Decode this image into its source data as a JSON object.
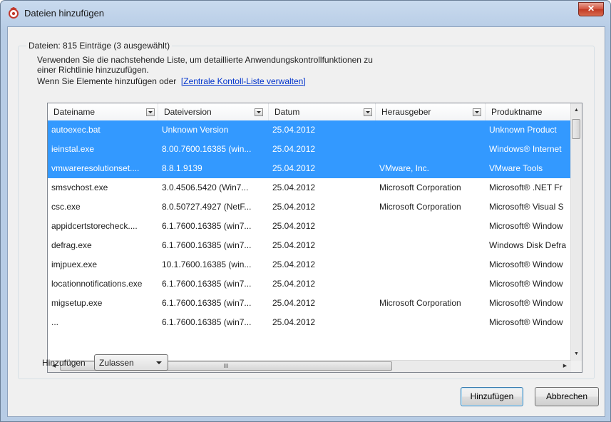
{
  "window": {
    "title": "Dateien hinzufügen",
    "close_glyph": "✕"
  },
  "group": {
    "label": "Dateien: 815 Einträge (3 ausgewählt)",
    "desc_line1": "Verwenden Sie die nachstehende Liste, um detaillierte Anwendungskontrollfunktionen zu",
    "desc_line2": "einer Richtlinie hinzuzufügen.",
    "desc_line3": "Wenn Sie Elemente hinzufügen oder",
    "desc_link": "[Zentrale Kontoll-Liste verwalten]"
  },
  "table": {
    "columns": [
      "Dateiname",
      "Dateiversion",
      "Datum",
      "Herausgeber",
      "Produktname"
    ],
    "rows": [
      {
        "name": "autoexec.bat",
        "version": "Unknown Version",
        "date": "25.04.2012",
        "publisher": "",
        "product": "Unknown Product",
        "selected": true
      },
      {
        "name": "ieinstal.exe",
        "version": "8.00.7600.16385 (win...",
        "date": "25.04.2012",
        "publisher": "",
        "product": "Windows® Internet",
        "selected": true
      },
      {
        "name": "vmwareresolutionset....",
        "version": "8.8.1.9139",
        "date": "25.04.2012",
        "publisher": "VMware, Inc.",
        "product": "VMware Tools",
        "selected": true
      },
      {
        "name": "smsvchost.exe",
        "version": "3.0.4506.5420 (Win7...",
        "date": "25.04.2012",
        "publisher": "Microsoft Corporation",
        "product": "Microsoft® .NET Fr",
        "selected": false
      },
      {
        "name": "csc.exe",
        "version": "8.0.50727.4927 (NetF...",
        "date": "25.04.2012",
        "publisher": "Microsoft Corporation",
        "product": "Microsoft® Visual S",
        "selected": false
      },
      {
        "name": "appidcertstorecheck....",
        "version": "6.1.7600.16385 (win7...",
        "date": "25.04.2012",
        "publisher": "",
        "product": "Microsoft® Window",
        "selected": false
      },
      {
        "name": "defrag.exe",
        "version": "6.1.7600.16385 (win7...",
        "date": "25.04.2012",
        "publisher": "",
        "product": "Windows Disk Defra",
        "selected": false
      },
      {
        "name": "imjpuex.exe",
        "version": "10.1.7600.16385 (win...",
        "date": "25.04.2012",
        "publisher": "",
        "product": "Microsoft® Window",
        "selected": false
      },
      {
        "name": "locationnotifications.exe",
        "version": "6.1.7600.16385 (win7...",
        "date": "25.04.2012",
        "publisher": "",
        "product": "Microsoft® Window",
        "selected": false
      },
      {
        "name": "migsetup.exe",
        "version": "6.1.7600.16385 (win7...",
        "date": "25.04.2012",
        "publisher": "Microsoft Corporation",
        "product": "Microsoft® Window",
        "selected": false
      },
      {
        "name": "...",
        "version": "6.1.7600.16385 (win7...",
        "date": "25.04.2012",
        "publisher": "",
        "product": "Microsoft® Window",
        "selected": false
      }
    ]
  },
  "scroll": {
    "up": "▲",
    "down": "▼",
    "left": "◀",
    "right": "▶",
    "grip": "III"
  },
  "footer": {
    "add_label": "Hinzufügen",
    "combo_value": "Zulassen",
    "ok_label": "Hinzufügen",
    "cancel_label": "Abbrechen"
  },
  "colors": {
    "selection": "#3399ff",
    "link": "#0033cc"
  },
  "icons": {
    "title": "app-shield-icon"
  }
}
